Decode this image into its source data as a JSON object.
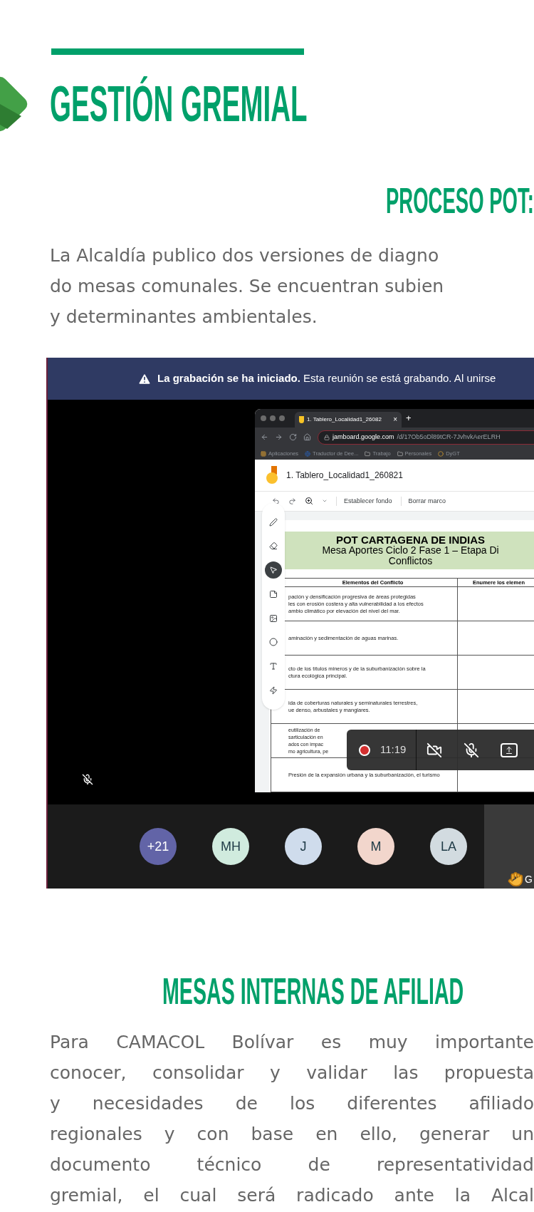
{
  "header": {
    "title": "GESTIÓN GREMIAL"
  },
  "pot_section": {
    "heading": "PROCESO POT:",
    "lines": [
      "La Alcaldía publico dos versiones de diagno",
      "do mesas comunales. Se encuentran subien",
      "y determinantes ambientales."
    ]
  },
  "meeting_screenshot": {
    "banner": "**La grabación se ha iniciado.** Esta reunión se está grabando. Al unirse",
    "browser": {
      "tab_title": "1. Tablero_Localidad1_26082",
      "close_tab": "×",
      "new_tab": "+",
      "url_host": "jamboard.google.com",
      "url_path": "/d/17Ob5oDl89tCR-7JvhvkAerELRH",
      "bookmarks": [
        {
          "kind": "apps",
          "label": "Aplicaciones"
        },
        {
          "kind": "globe",
          "label": "Traductor de Dee..."
        },
        {
          "kind": "folder",
          "label": "Trabajo"
        },
        {
          "kind": "folder",
          "label": "Personales"
        },
        {
          "kind": "circle",
          "label": "DyGT"
        }
      ]
    },
    "jamboard": {
      "title": "1. Tablero_Localidad1_260821",
      "toolbar": [
        "Establecer fondo",
        "Borrar marco"
      ],
      "tools": [
        {
          "kind": "pen",
          "selected": false
        },
        {
          "kind": "eraser",
          "selected": false
        },
        {
          "kind": "select",
          "selected": true
        },
        {
          "kind": "note",
          "selected": false
        },
        {
          "kind": "image",
          "selected": false
        },
        {
          "kind": "circle",
          "selected": false
        },
        {
          "kind": "textbox",
          "selected": false
        },
        {
          "kind": "laser",
          "selected": false
        }
      ],
      "board_heading": [
        "POT CARTAGENA DE INDIAS",
        "Mesa Aportes Ciclo 2 Fase 1 – Etapa Di",
        "Conflictos"
      ],
      "table": {
        "columns": [
          "Elementos del Conflicto",
          "Enumere los elemen"
        ],
        "rows": [
          [
            "pación y densificación progresiva de áreas protegidas",
            "les con erosión costera y alta vulnerabilidad a los efectos",
            "ambio climático por elevación del nivel del mar."
          ],
          [
            "aminación y sedimentación de aguas marinas."
          ],
          [
            "cto de los títulos mineros y de la suburbanización sobre la",
            "ctura ecológica principal."
          ],
          [
            "ida de coberturas naturales y seminaturales terrestres,",
            "ue denso, arbustales y manglares."
          ],
          [
            "eutilización de",
            "sarticulación en",
            "ados con impac",
            "mo agricultura, pe"
          ],
          [
            "Presión de la expansión urbana y la suburbanización, el turismo"
          ]
        ]
      }
    },
    "recording": {
      "on": true,
      "time": "11:19",
      "camera_on": false,
      "mic_on": false
    },
    "presenter_muted": true,
    "participants": [
      {
        "initials": "+21",
        "color": "#6264a7"
      },
      {
        "initials": "MH",
        "color": "#d0ebde"
      },
      {
        "initials": "J",
        "color": "#cfdcec"
      },
      {
        "initials": "M",
        "color": "#f2d6cc"
      },
      {
        "initials": "LA",
        "color": "#d2dbe0"
      }
    ],
    "raised_hand": {
      "name": "G"
    }
  },
  "affiliates_section": {
    "heading": "MESAS INTERNAS DE AFILIAD",
    "lines": [
      "Para CAMACOL Bolívar es muy importante",
      "conocer, consolidar y validar las propuesta",
      "y necesidades de los diferentes afiliado",
      "regionales y con base en ello, generar un",
      "documento técnico de representatividad",
      "gremial, el cual será radicado ante la Alcal"
    ]
  }
}
